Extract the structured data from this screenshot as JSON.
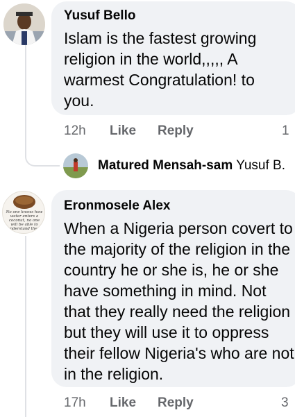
{
  "comments": [
    {
      "author": "Yusuf Bello",
      "text": "Islam is the fastest growing religion in the world,,,,, A warmest Congratulation! to you.",
      "time": "12h",
      "like": "Like",
      "reply": "Reply",
      "reactions": "1",
      "replies": [
        {
          "author": "Matured Mensah-sam",
          "text": "Yusuf B."
        }
      ]
    },
    {
      "author": "Eronmosele Alex",
      "text": "When a Nigeria person covert to the majority of the religion in the country he or she is, he or she have something in mind. Not that they really need the religion but they will use it to oppress their fellow Nigeria's who are not in the religion.",
      "avatar_text": "No one knows how water enters a coconut, no one will be able to understand the...",
      "time": "17h",
      "like": "Like",
      "reply": "Reply",
      "reactions": "3"
    }
  ]
}
